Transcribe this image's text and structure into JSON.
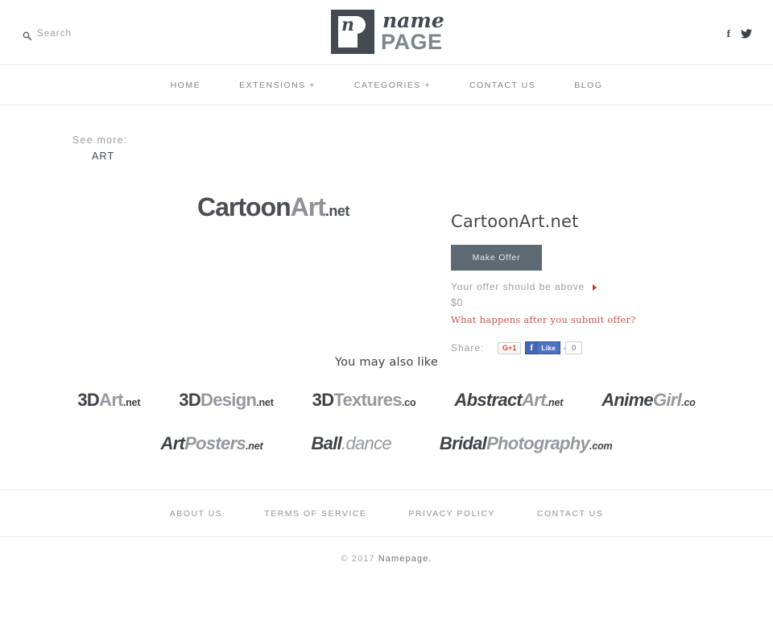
{
  "header": {
    "search": {
      "label": "Search",
      "icon": "search-icon"
    },
    "logo": {
      "mark_letter": "n",
      "name": "name",
      "page": "PAGE"
    },
    "social": [
      {
        "name": "facebook-icon",
        "glyph": "f"
      },
      {
        "name": "twitter-icon",
        "glyph": "twitter-bird"
      }
    ]
  },
  "nav": {
    "items": [
      {
        "label": "HOME"
      },
      {
        "label": "EXTENSIONS +"
      },
      {
        "label": "CATEGORIES +"
      },
      {
        "label": "CONTACT US"
      },
      {
        "label": "BLOG"
      }
    ]
  },
  "seemore": {
    "label": "See more:",
    "value": "ART"
  },
  "main": {
    "hero_logo": {
      "part_a": "Cartoon",
      "part_b": "Art",
      "tld": ".net"
    },
    "domain_title": "CartoonArt.net",
    "make_offer_label": "Make Offer",
    "offer_above_text": "Your offer should be above",
    "offer_amount": "$0",
    "what_happens_link": "What happens after you submit offer?",
    "share": {
      "label": "Share:",
      "gplus_label": "G+1",
      "facebook_f": "f",
      "facebook_like_label": "Like",
      "facebook_count": "0"
    }
  },
  "also_like": {
    "title": "You may also like",
    "rows": [
      [
        {
          "part_a": "3D",
          "part_b": "Art",
          "tld": ".net",
          "size": 22,
          "italic": false
        },
        {
          "part_a": "3D",
          "part_b": "Design",
          "tld": ".net",
          "size": 22,
          "italic": false
        },
        {
          "part_a": "3D",
          "part_b": "Textures",
          "tld": ".co",
          "size": 22,
          "italic": false
        },
        {
          "part_a": "Abstract",
          "part_b": "Art",
          "tld": ".net",
          "size": 22,
          "italic": true
        },
        {
          "part_a": "Anime",
          "part_b": "Girl",
          "tld": ".co",
          "size": 22,
          "italic": true
        }
      ],
      [
        {
          "part_a": "Art",
          "part_b": "Posters",
          "tld": ".net",
          "size": 22,
          "italic": true
        },
        {
          "part_a": "Ball",
          "part_b": ".dance",
          "tld": "",
          "size": 22,
          "italic": true
        },
        {
          "part_a": "Bridal",
          "part_b": "Photography",
          "tld": ".com",
          "size": 22,
          "italic": true
        }
      ]
    ]
  },
  "footer": {
    "links": [
      {
        "label": "ABOUT US"
      },
      {
        "label": "TERMS OF SERVICE"
      },
      {
        "label": "PRIVACY POLICY"
      },
      {
        "label": "CONTACT US"
      }
    ],
    "copyright": "© 2017",
    "brand": "Namepage."
  },
  "colors": {
    "accent_button": "#5d6a74",
    "link_red": "#c0564f",
    "arrow_red": "#c0392b",
    "logo_dark": "#434a52",
    "logo_light": "#7d858d",
    "text_muted": "#9a9da0",
    "facebook_blue": "#4267b2",
    "gplus_red": "#d34836"
  }
}
